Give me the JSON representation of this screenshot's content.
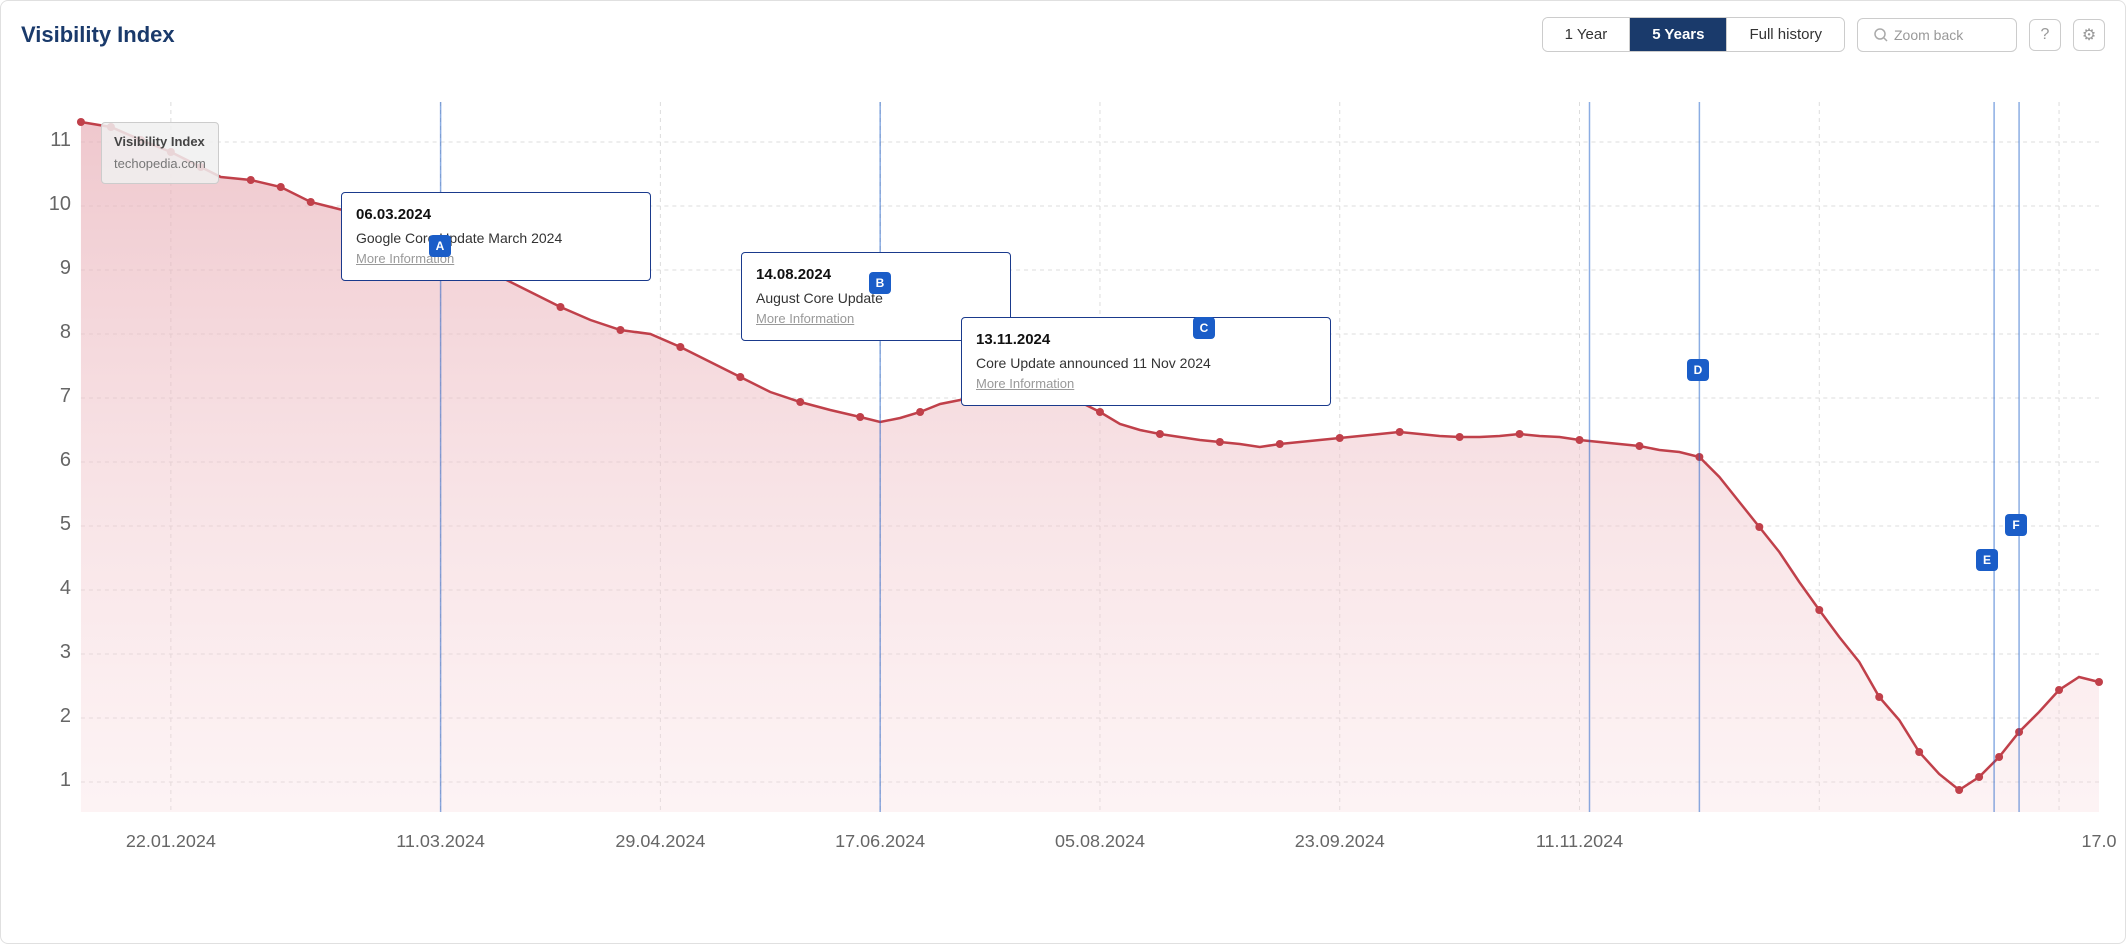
{
  "header": {
    "title": "Visibility Index",
    "time_buttons": [
      {
        "label": "1 Year",
        "active": false
      },
      {
        "label": "5 Years",
        "active": true
      },
      {
        "label": "Full history",
        "active": false
      }
    ],
    "zoom_back_label": "Zoom back",
    "zoom_back_placeholder": "Zoom back"
  },
  "chart": {
    "y_axis_labels": [
      "1",
      "2",
      "3",
      "4",
      "5",
      "6",
      "7",
      "8",
      "9",
      "10",
      "11"
    ],
    "x_axis_labels": [
      "22.01.2024",
      "11.03.2024",
      "29.04.2024",
      "17.06.2024",
      "05.08.2024",
      "23.09.2024",
      "11.11.2024",
      "17.0"
    ],
    "legend": {
      "title": "Visibility Index",
      "subtitle": "techopedia.com"
    }
  },
  "tooltips": [
    {
      "id": "A",
      "date": "06.03.2024",
      "description": "Google Core Update March 2024",
      "more": "More Information"
    },
    {
      "id": "B",
      "date": "14.08.2024",
      "description": "August Core Update",
      "more": "More Information"
    },
    {
      "id": "C",
      "date": "13.11.2024",
      "description": "Core Update announced 11 Nov 2024",
      "more": "More Information"
    },
    {
      "id": "D",
      "date": "",
      "description": "",
      "more": ""
    },
    {
      "id": "E",
      "date": "",
      "description": "",
      "more": ""
    },
    {
      "id": "F",
      "date": "",
      "description": "",
      "more": ""
    }
  ]
}
